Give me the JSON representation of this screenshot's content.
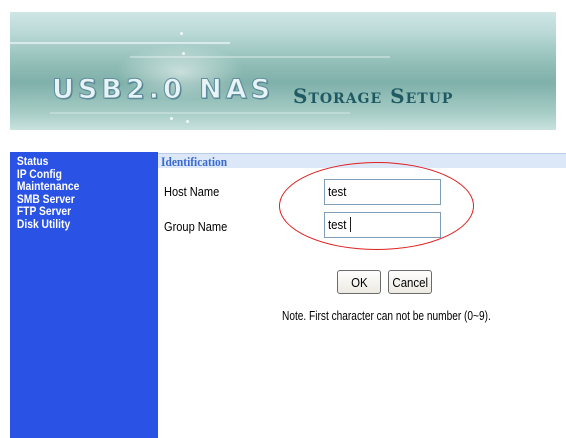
{
  "banner": {
    "product_title": "USB2.0 NAS",
    "page_title": "Storage Setup"
  },
  "sidebar": {
    "items": [
      {
        "label": "Status"
      },
      {
        "label": "IP Config"
      },
      {
        "label": "Maintenance"
      },
      {
        "label": "SMB Server"
      },
      {
        "label": "FTP Server"
      },
      {
        "label": "Disk Utility"
      }
    ]
  },
  "identification": {
    "header": "Identification",
    "host_name_label": "Host Name",
    "host_name_value": "test",
    "group_name_label": "Group Name",
    "group_name_value": "test"
  },
  "buttons": {
    "ok_label": "OK",
    "cancel_label": "Cancel"
  },
  "note": "Note. First character can not be number (0~9).",
  "colors": {
    "sidebar_bg": "#2a52e4",
    "header_bg": "#dce8f8",
    "header_text": "#3a6ad0",
    "highlight_ellipse": "#e02020"
  }
}
